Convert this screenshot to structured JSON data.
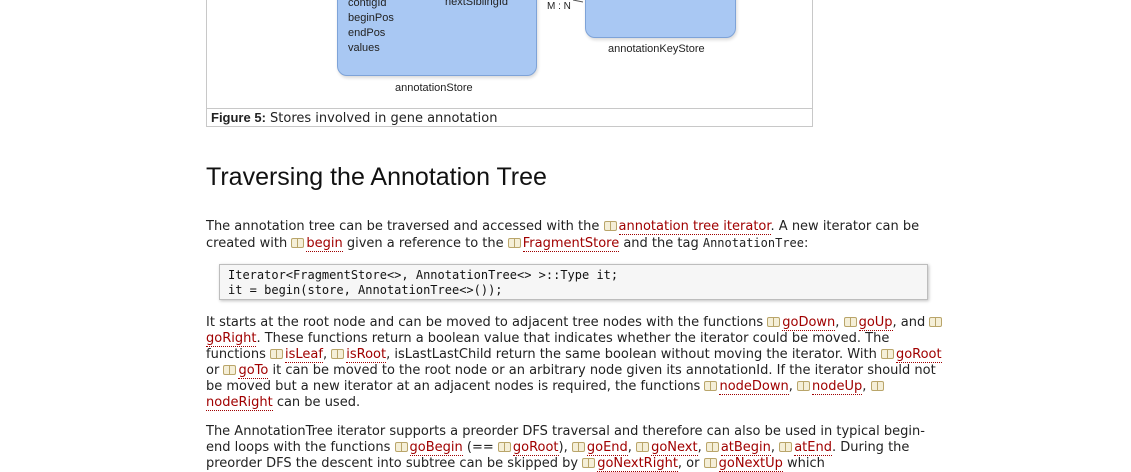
{
  "figure": {
    "annotation_store": {
      "fields": [
        "contigId",
        "beginPos",
        "endPos",
        "values"
      ],
      "sibling_field": "nextSiblingId",
      "label": "annotationStore"
    },
    "relation_label": "M : N",
    "key_store": {
      "label": "annotationKeyStore"
    },
    "caption": {
      "prefix": "Figure 5:",
      "text": " Stores involved in gene annotation"
    }
  },
  "section": {
    "title": "Traversing the Annotation Tree"
  },
  "p1": {
    "t1": "The annotation tree can be traversed and accessed with the ",
    "l1": "annotation tree iterator",
    "t2": ". A new iterator can be created with ",
    "l2": "begin",
    "t3": " given a reference to the ",
    "l3": "FragmentStore",
    "t4": " and the tag ",
    "code": "AnnotationTree",
    "t5": ":"
  },
  "code_block": {
    "line1": "Iterator<FragmentStore<>, AnnotationTree<> >::Type it;",
    "line2": "it = begin(store, AnnotationTree<>());"
  },
  "p2": {
    "t1": "It starts at the root node and can be moved to adjacent tree nodes with the functions ",
    "goDown": "goDown",
    "t2": ", ",
    "goUp": "goUp",
    "t3": ", and ",
    "goRight": "goRight",
    "t4": ". These functions return a boolean value that indicates whether the iterator could be moved. The functions ",
    "isLeaf": "isLeaf",
    "t5": ", ",
    "isRoot": "isRoot",
    "t6": ", isLastLastChild return the same boolean without moving the iterator. With ",
    "goRoot": "goRoot",
    "t7": " or ",
    "goTo": "goTo",
    "t8": " it can be moved to the root node or an arbitrary node given its annotationId. If the iterator should not be moved but a new iterator at an adjacent nodes is required, the functions ",
    "nodeDown": "nodeDown",
    "t9": ", ",
    "nodeUp": "nodeUp",
    "t10": ", ",
    "nodeRight": "nodeRight",
    "t11": " can be used."
  },
  "p3": {
    "t1": "The AnnotationTree iterator supports a preorder DFS traversal and therefore can also be used in typical begin-end loops with the functions ",
    "goBegin": "goBegin",
    "t2": " (== ",
    "goRoot": "goRoot",
    "t3": "), ",
    "goEnd": "goEnd",
    "t4": ", ",
    "goNext": "goNext",
    "t5": ", ",
    "atBegin": "atBegin",
    "t6": ", ",
    "atEnd": "atEnd",
    "t7": ". During the preorder DFS the descent into subtree can be skipped by ",
    "goNextRight": "goNextRight",
    "t8": ", or ",
    "goNextUp": "goNextUp",
    "t9": " which"
  }
}
